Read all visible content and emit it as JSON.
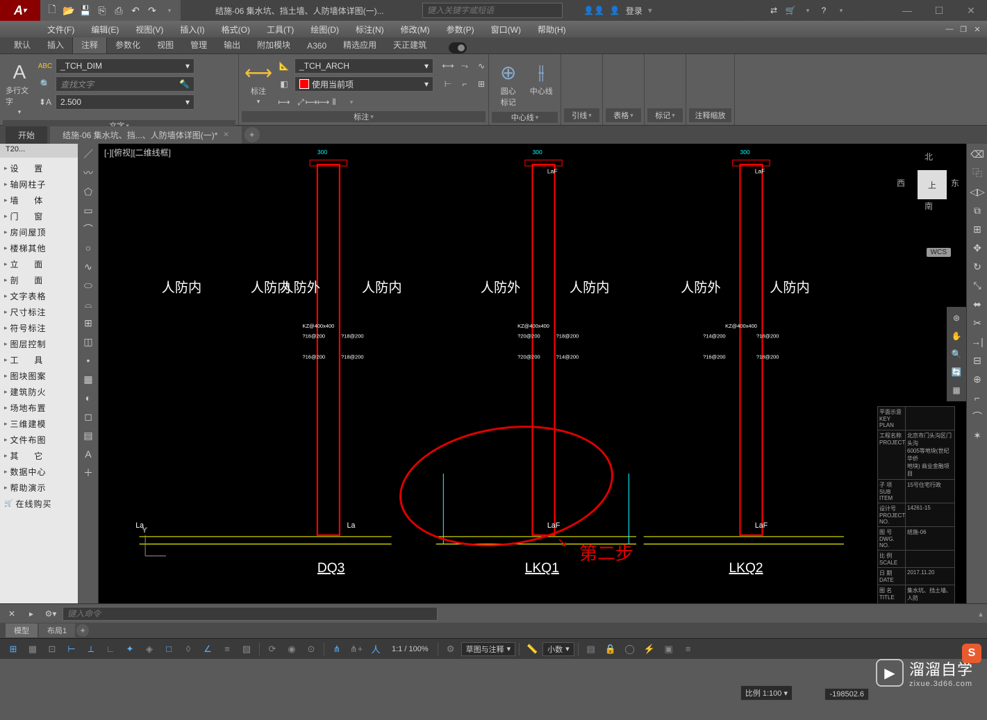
{
  "titlebar": {
    "doc_title": "结施-06 集水坑、挡土墙、人防墙体详图(一)...",
    "search_placeholder": "键入关键字或短语",
    "login": "登录"
  },
  "menubar": [
    "文件(F)",
    "编辑(E)",
    "视图(V)",
    "插入(I)",
    "格式(O)",
    "工具(T)",
    "绘图(D)",
    "标注(N)",
    "修改(M)",
    "参数(P)",
    "窗口(W)",
    "帮助(H)"
  ],
  "ribbon_tabs": [
    "默认",
    "插入",
    "注释",
    "参数化",
    "视图",
    "管理",
    "输出",
    "附加模块",
    "A360",
    "精选应用",
    "天正建筑"
  ],
  "ribbon": {
    "text_btn": "多行文字",
    "text_style": "_TCH_DIM",
    "text_find": "查找文字",
    "text_height": "2.500",
    "text_panel": "文字",
    "dim_btn": "标注",
    "dim_style": "_TCH_ARCH",
    "dim_layer": "使用当前项",
    "dim_panel": "标注",
    "center_btn1": "圆心\n标记",
    "center_btn2": "中心线",
    "center_panel": "中心线",
    "leader_panel": "引线",
    "table_panel": "表格",
    "mark_panel": "标记",
    "scale_panel": "注释缩放"
  },
  "doc_tabs": {
    "start": "开始",
    "doc1": "结施-06 集水坑、挡...、人防墙体详图(一)*"
  },
  "left_panel": {
    "tab": "T20...",
    "items": [
      "设 　 置",
      "轴网柱子",
      "墙 　 体",
      "门 　 窗",
      "房间屋顶",
      "楼梯其他",
      "立 　 面",
      "剖 　 面",
      "文字表格",
      "尺寸标注",
      "符号标注",
      "图层控制",
      "工 　 具",
      "图块图案",
      "建筑防火",
      "场地布置",
      "三维建模",
      "文件布图",
      "其 　 它",
      "数据中心",
      "帮助演示",
      "在线购买"
    ]
  },
  "viewport_label": "[-][俯视][二维线框]",
  "nav": {
    "n": "北",
    "s": "南",
    "e": "东",
    "w": "西",
    "top": "上"
  },
  "wcs": "WCS",
  "drawing": {
    "labels": {
      "inside": "人防内",
      "outside": "人防外"
    },
    "sections": [
      "DQ3",
      "LKQ1",
      "LKQ2"
    ],
    "dim_laf": "LaF",
    "dim_la": "La",
    "dim_300": "300",
    "kz": "KZ@400x400",
    "bar1": "?16@200",
    "bar2": "?18@200",
    "bar3": "?20@200",
    "bar4": "?14@200",
    "step_text": "第二步"
  },
  "title_block": {
    "keyplan": "平面示意",
    "keyplan_en": "KEY PLAN",
    "proj": "工程名称",
    "proj_en": "PROJECT",
    "proj_v": "北京市门头沟区门头沟\n6005等地块(世纪华侨\n地块) 商业金融项目",
    "sub": "子 项",
    "sub_en": "SUB ITEM",
    "sub_v": "15号住宅行政",
    "no": "设计号",
    "no_en": "PROJECT NO.",
    "no_v": "14261-15",
    "dwg": "图 号",
    "dwg_en": "DWG. NO.",
    "dwg_v": "结施-06",
    "scale": "比 例",
    "scale_en": "SCALE",
    "date": "日 期",
    "date_en": "DATE",
    "date_v": "2017.11.20",
    "title": "图 名",
    "title_en": "TITLE",
    "title_v": "集水坑、挡土墙、人防"
  },
  "cmdline": {
    "placeholder": "键入命令"
  },
  "layout_tabs": [
    "模型",
    "布局1"
  ],
  "statusbar": {
    "zoom": "1:1 / 100%",
    "draft": "草图与注释",
    "decimal": "小数",
    "scale": "比例 1:100",
    "coords": "-198502.6"
  },
  "watermark": {
    "cn": "溜溜自学",
    "en": "zixue.3d66.com"
  }
}
